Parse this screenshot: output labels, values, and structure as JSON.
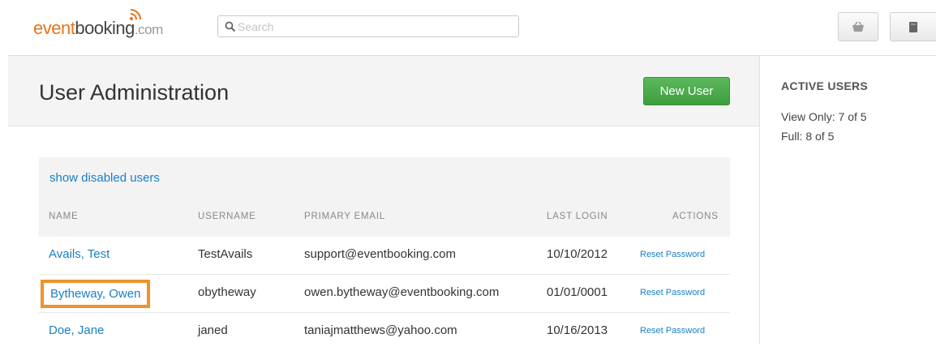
{
  "header": {
    "logo": {
      "part1": "event",
      "part2": "booking",
      "part3": ".com"
    },
    "search": {
      "placeholder": "Search",
      "value": ""
    },
    "icons": [
      "basket-icon",
      "book-icon"
    ]
  },
  "page": {
    "title": "User Administration",
    "new_user_label": "New User"
  },
  "users_panel": {
    "show_disabled_label": "show disabled users",
    "columns": [
      "NAME",
      "USERNAME",
      "PRIMARY EMAIL",
      "LAST LOGIN",
      "ACTIONS"
    ],
    "rows": [
      {
        "name": "Avails, Test",
        "username": "TestAvails",
        "email": "support@eventbooking.com",
        "last_login": "10/10/2012",
        "action": "Reset Password"
      },
      {
        "name": "Bytheway, Owen",
        "username": "obytheway",
        "email": "owen.bytheway@eventbooking.com",
        "last_login": "01/01/0001",
        "action": "Reset Password"
      },
      {
        "name": "Doe, Jane",
        "username": "janed",
        "email": "taniajmatthews@yahoo.com",
        "last_login": "10/16/2013",
        "action": "Reset Password"
      }
    ]
  },
  "sidebar": {
    "title": "ACTIVE USERS",
    "lines": [
      "View Only: 7 of 5",
      "Full: 8 of 5"
    ]
  },
  "colors": {
    "brand_orange": "#e8731a",
    "link_blue": "#1a80c4",
    "button_green": "#4cae4c",
    "highlight_orange": "#f0922b"
  }
}
